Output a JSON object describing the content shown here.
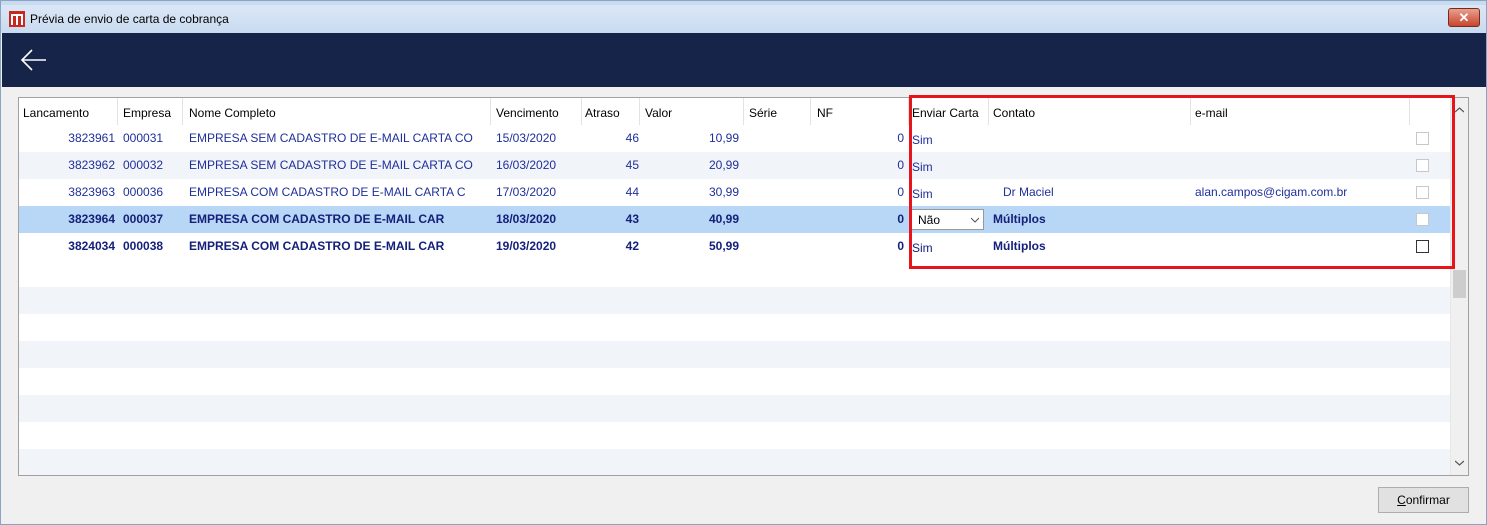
{
  "window": {
    "title": "Prévia de envio de carta de cobrança",
    "close_label": "✕"
  },
  "grid": {
    "columns": [
      "Lancamento",
      "Empresa",
      "Nome Completo",
      "Vencimento",
      "Atraso",
      "Valor",
      "Série",
      "NF",
      "Enviar Carta",
      "Contato",
      "e-mail"
    ],
    "rows": [
      {
        "lancamento": "3823961",
        "empresa": "000031",
        "nome": "EMPRESA SEM CADASTRO DE E-MAIL CARTA CO",
        "vencimento": "15/03/2020",
        "atraso": "46",
        "valor": "10,99",
        "serie": "",
        "nf": "0",
        "enviar": "Sim",
        "contato": "",
        "email": ""
      },
      {
        "lancamento": "3823962",
        "empresa": "000032",
        "nome": "EMPRESA SEM CADASTRO DE E-MAIL CARTA CO",
        "vencimento": "16/03/2020",
        "atraso": "45",
        "valor": "20,99",
        "serie": "",
        "nf": "0",
        "enviar": "Sim",
        "contato": "",
        "email": ""
      },
      {
        "lancamento": "3823963",
        "empresa": "000036",
        "nome": "EMPRESA COM CADASTRO DE E-MAIL CARTA C",
        "vencimento": "17/03/2020",
        "atraso": "44",
        "valor": "30,99",
        "serie": "",
        "nf": "0",
        "enviar": "Sim",
        "contato": "Dr Maciel",
        "email": "alan.campos@cigam.com.br"
      },
      {
        "lancamento": "3823964",
        "empresa": "000037",
        "nome": "EMPRESA COM CADASTRO DE E-MAIL CAR",
        "vencimento": "18/03/2020",
        "atraso": "43",
        "valor": "40,99",
        "serie": "",
        "nf": "0",
        "enviar": "Não",
        "contato": "Múltiplos",
        "email": ""
      },
      {
        "lancamento": "3824034",
        "empresa": "000038",
        "nome": "EMPRESA COM CADASTRO DE E-MAIL CAR",
        "vencimento": "19/03/2020",
        "atraso": "42",
        "valor": "50,99",
        "serie": "",
        "nf": "0",
        "enviar": "Sim",
        "contato": "Múltiplos",
        "email": ""
      }
    ]
  },
  "footer": {
    "confirm_first": "C",
    "confirm_rest": "onfirmar"
  },
  "colors": {
    "header_bg": "#152448",
    "row_text": "#1f2f9a",
    "selected_row": "#b8d6f6",
    "highlight_box": "#e8141c"
  },
  "icons": {
    "back": "arrow-left-icon",
    "app": "app-logo-icon",
    "close": "close-icon"
  }
}
